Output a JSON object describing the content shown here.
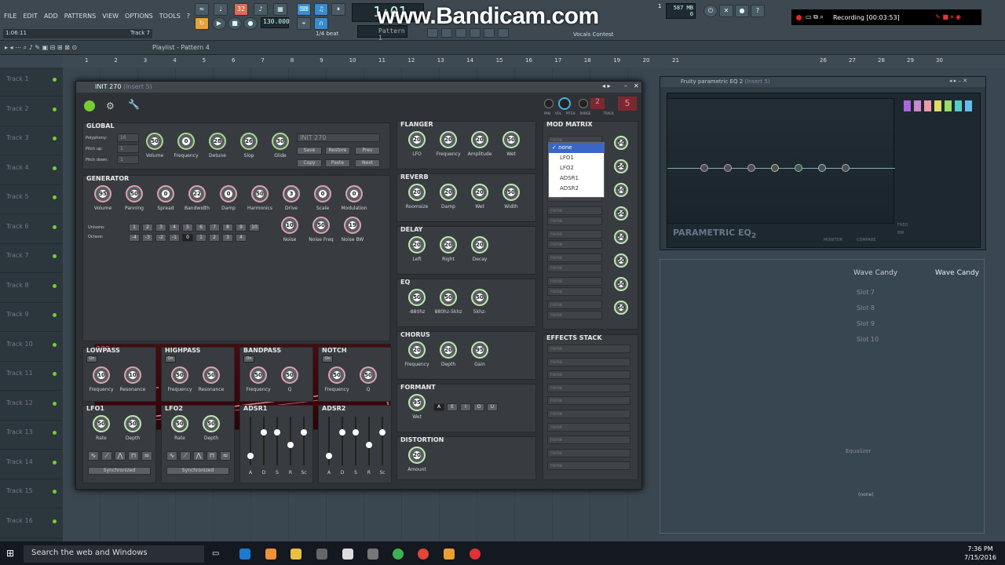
{
  "menu": {
    "items": [
      "FILE",
      "EDIT",
      "ADD",
      "PATTERNS",
      "VIEW",
      "OPTIONS",
      "TOOLS",
      "?"
    ]
  },
  "hint": {
    "time": "1:06:11",
    "track": "Track 7"
  },
  "transport": {
    "bpm": "130.000",
    "pattern": "Pattern 1",
    "time": "1:01",
    "cpu": "587 MB",
    "cpu_small": "0",
    "step": "1/4 beat",
    "news1": "Vocals Contest",
    "beat_small": "1"
  },
  "overlay": {
    "watermark": "www.Bandicam.com",
    "recording": "Recording [00:03:53]"
  },
  "playlist": {
    "title": "Playlist - Pattern 4",
    "ruler": [
      "1",
      "2",
      "3",
      "4",
      "5",
      "6",
      "7",
      "8",
      "9",
      "10",
      "11",
      "12",
      "13",
      "14",
      "15",
      "16",
      "17",
      "18",
      "19",
      "20",
      "21"
    ],
    "ruler_eq": [
      "26",
      "27",
      "28",
      "29",
      "30"
    ],
    "tracks": [
      "Track 1",
      "Track 2",
      "Track 3",
      "Track 4",
      "Track 5",
      "Track 6",
      "Track 7",
      "Track 8",
      "Track 9",
      "Track 10",
      "Track 11",
      "Track 12",
      "Track 13",
      "Track 14",
      "Track 15",
      "Track 16"
    ]
  },
  "plugin": {
    "title": "INIT 270",
    "title_sub": "(Insert 5)",
    "header": {
      "pan": "PAN",
      "vol": "VOL",
      "pitch": "PITCH",
      "range": "RANGE",
      "track": "TRACK",
      "range_val": "2",
      "track_val": "5"
    },
    "global": {
      "title": "GLOBAL",
      "polyphony_label": "Polyphony:",
      "polyphony": "16",
      "pitchup_label": "Pitch up:",
      "pitchup": "1",
      "pitchdown_label": "Pitch down:",
      "pitchdown": "1",
      "preset": "INIT 270",
      "knobs": [
        {
          "label": "Volume",
          "value": "50"
        },
        {
          "label": "Frequency",
          "value": "0"
        },
        {
          "label": "Detune",
          "value": "28"
        },
        {
          "label": "Slop",
          "value": "26"
        },
        {
          "label": "Glide",
          "value": "30"
        }
      ],
      "buttons": [
        "Save",
        "Restore",
        "Prev",
        "Copy",
        "Paste",
        "Next"
      ]
    },
    "generator": {
      "title": "GENERATOR",
      "knobs": [
        {
          "label": "Volume",
          "value": "95"
        },
        {
          "label": "Panning",
          "value": "50"
        },
        {
          "label": "Spread",
          "value": "0"
        },
        {
          "label": "Bandwidth",
          "value": "22"
        },
        {
          "label": "Damp",
          "value": "0"
        },
        {
          "label": "Harmonics",
          "value": "50"
        },
        {
          "label": "Drive",
          "value": "3"
        },
        {
          "label": "Scale",
          "value": "0"
        },
        {
          "label": "Modulation",
          "value": "0"
        }
      ],
      "unisono_label": "Unisono:",
      "unisono": [
        "1",
        "2",
        "3",
        "4",
        "5",
        "6",
        "7",
        "8",
        "9",
        "10"
      ],
      "octave_label": "Octave:",
      "octave": [
        "-4",
        "-3",
        "-2",
        "-1",
        "0",
        "1",
        "2",
        "3",
        "4"
      ],
      "noise_knobs": [
        {
          "label": "Noise",
          "value": "10"
        },
        {
          "label": "Noise Freq",
          "value": "50"
        },
        {
          "label": "Noise BW",
          "value": "19"
        }
      ]
    },
    "filters": [
      {
        "title": "LOWPASS",
        "on": "On",
        "knobs": [
          {
            "label": "Frequency",
            "value": "10"
          },
          {
            "label": "Resonance",
            "value": "10"
          }
        ]
      },
      {
        "title": "HIGHPASS",
        "on": "On",
        "knobs": [
          {
            "label": "Frequency",
            "value": "50"
          },
          {
            "label": "Resonance",
            "value": "50"
          }
        ]
      },
      {
        "title": "BANDPASS",
        "on": "On",
        "knobs": [
          {
            "label": "Frequency",
            "value": "50"
          },
          {
            "label": "Q",
            "value": "50"
          }
        ]
      },
      {
        "title": "NOTCH",
        "on": "On",
        "knobs": [
          {
            "label": "Frequency",
            "value": "50"
          },
          {
            "label": "Q",
            "value": "50"
          }
        ]
      }
    ],
    "lfos": [
      {
        "title": "LFO1",
        "knobs": [
          {
            "label": "Rate",
            "value": "50"
          },
          {
            "label": "Depth",
            "value": "50"
          }
        ],
        "sync": "Synchronized"
      },
      {
        "title": "LFO2",
        "knobs": [
          {
            "label": "Rate",
            "value": "50"
          },
          {
            "label": "Depth",
            "value": "50"
          }
        ],
        "sync": "Synchronized"
      }
    ],
    "adsrs": [
      {
        "title": "ADSR1",
        "labels": [
          "A",
          "D",
          "S",
          "R",
          "Sc"
        ]
      },
      {
        "title": "ADSR2",
        "labels": [
          "A",
          "D",
          "S",
          "R",
          "Sc"
        ]
      }
    ],
    "flanger": {
      "title": "FLANGER",
      "knobs": [
        {
          "label": "LFO",
          "value": "20"
        },
        {
          "label": "Frequency",
          "value": "20"
        },
        {
          "label": "Amplitude",
          "value": "20"
        },
        {
          "label": "Wet",
          "value": "50"
        }
      ]
    },
    "reverb": {
      "title": "REVERB",
      "knobs": [
        {
          "label": "Roomsize",
          "value": "20"
        },
        {
          "label": "Damp",
          "value": "20"
        },
        {
          "label": "Wet",
          "value": "20"
        },
        {
          "label": "Width",
          "value": "50"
        }
      ]
    },
    "delay": {
      "title": "DELAY",
      "knobs": [
        {
          "label": "Left",
          "value": "20"
        },
        {
          "label": "Right",
          "value": "20"
        },
        {
          "label": "Decay",
          "value": "20"
        }
      ]
    },
    "eq": {
      "title": "EQ",
      "knobs": [
        {
          "label": "-880hz",
          "value": "50"
        },
        {
          "label": "880hz-5khz",
          "value": "50"
        },
        {
          "label": "5khz-",
          "value": "50"
        }
      ]
    },
    "chorus": {
      "title": "CHORUS",
      "knobs": [
        {
          "label": "Frequency",
          "value": "20"
        },
        {
          "label": "Depth",
          "value": "20"
        },
        {
          "label": "Gain",
          "value": "95"
        }
      ]
    },
    "formant": {
      "title": "FORMANT",
      "knob": {
        "label": "Wet",
        "value": "95"
      },
      "vowels": [
        "A",
        "E",
        "I",
        "O",
        "U"
      ]
    },
    "distortion": {
      "title": "DISTORTION",
      "knob": {
        "label": "Amount",
        "value": "20"
      }
    },
    "modmatrix": {
      "title": "MOD MATRIX",
      "none": "none",
      "dropdown": [
        "none",
        "LFO1",
        "LFO2",
        "ADSR1",
        "ADSR2"
      ],
      "knob_value": "50"
    },
    "effects": {
      "title": "EFFECTS STACK",
      "none": "none"
    }
  },
  "eqwin": {
    "title": "Fruity parametric EQ 2",
    "title_sub": "(Insert 5)",
    "brand": "PARAMETRIC EQ",
    "brand_num": "2",
    "monitor": "MONITOR",
    "compare": "COMPARE",
    "freq": "FREQ",
    "bw": "BW"
  },
  "mixer": {
    "slot": "Wave Candy",
    "slot2": "Wave Candy",
    "slots": [
      "Slot 7",
      "Slot 8",
      "Slot 9",
      "Slot 10"
    ],
    "equalizer": "Equalizer",
    "none": "(none)"
  },
  "taskbar": {
    "search": "Search the web and Windows",
    "time": "7:36 PM",
    "date": "7/15/2016"
  }
}
